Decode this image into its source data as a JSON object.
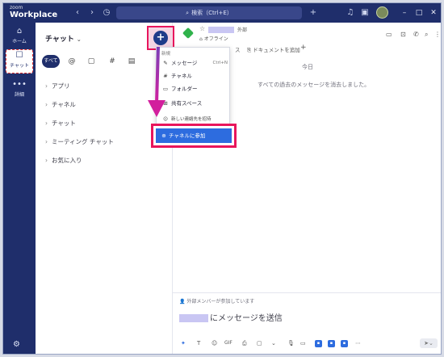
{
  "titlebar": {
    "brand_small": "zoom",
    "brand_big": "Workplace",
    "search_text": "検索（Ctrl+E）",
    "icons": [
      "chevron-left-icon",
      "chevron-right-icon",
      "history-icon",
      "plus-icon",
      "bell-icon",
      "bookmark-icon"
    ]
  },
  "rail": {
    "home": "ホーム",
    "chat": "チャット",
    "more": "詳細"
  },
  "list": {
    "title": "チャット",
    "filter_all": "すべて",
    "sections": [
      "アプリ",
      "チャネル",
      "チャット",
      "ミーティング チャット",
      "お気に入り"
    ]
  },
  "chat": {
    "external_tag": "外部",
    "status": "オフライン",
    "tab_documents": "ドキュメントを追加",
    "tab_partial": "ス",
    "today": "今日",
    "deleted_notice": "すべての過去のメッセージを消去しました。",
    "external_notice": "外部メンバーが参加しています",
    "compose_placeholder": "にメッセージを送信"
  },
  "menu": {
    "header": "新規",
    "items": [
      {
        "icon": "compose-icon",
        "label": "メッセージ",
        "shortcut": "Ctrl+N"
      },
      {
        "icon": "hash-icon",
        "label": "チャネル",
        "shortcut": ""
      },
      {
        "icon": "folder-icon",
        "label": "フォルダー",
        "shortcut": ""
      },
      {
        "icon": "shared-space-icon",
        "label": "共有スペース",
        "shortcut": ""
      },
      {
        "icon": "contact-icon",
        "label": "新しい連絡先を招待",
        "shortcut": ""
      }
    ],
    "join_channel": "チャネルに参加"
  },
  "colors": {
    "navy": "#1f2e6b",
    "highlight": "#e8155c",
    "arrow": "#c21aa0",
    "primary_blue": "#2d6cdf"
  }
}
